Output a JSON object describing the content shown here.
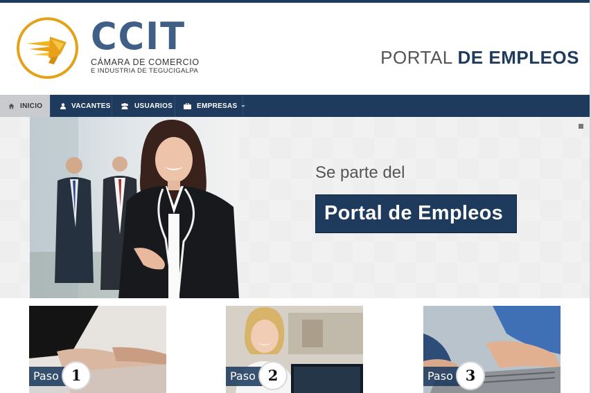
{
  "header": {
    "brand_name": "CCIT",
    "brand_line1": "CÁMARA DE COMERCIO",
    "brand_line2": "E INDUSTRIA DE TEGUCIGALPA",
    "portal_title_light": "PORTAL ",
    "portal_title_bold": "DE EMPLEOS",
    "logo_icon": "winged-helmet-logo"
  },
  "nav": {
    "items": [
      {
        "label": "INICIO",
        "icon": "home-icon",
        "active": true
      },
      {
        "label": "VACANTES",
        "icon": "user-icon",
        "active": false
      },
      {
        "label": "USUARIOS",
        "icon": "users-icon",
        "active": false
      },
      {
        "label": "EMPRESAS",
        "icon": "briefcase-icon",
        "active": false,
        "dropdown": true
      }
    ]
  },
  "hero": {
    "subtitle": "Se parte del",
    "banner_text": "Portal de Empleos"
  },
  "steps": [
    {
      "label": "Paso",
      "number": "1"
    },
    {
      "label": "Paso",
      "number": "2"
    },
    {
      "label": "Paso",
      "number": "3"
    }
  ],
  "colors": {
    "navy": "#1e3b5e",
    "brand_blue": "#3f5f86",
    "logo_gold": "#e3a21a",
    "nav_active": "#c9cbce"
  }
}
